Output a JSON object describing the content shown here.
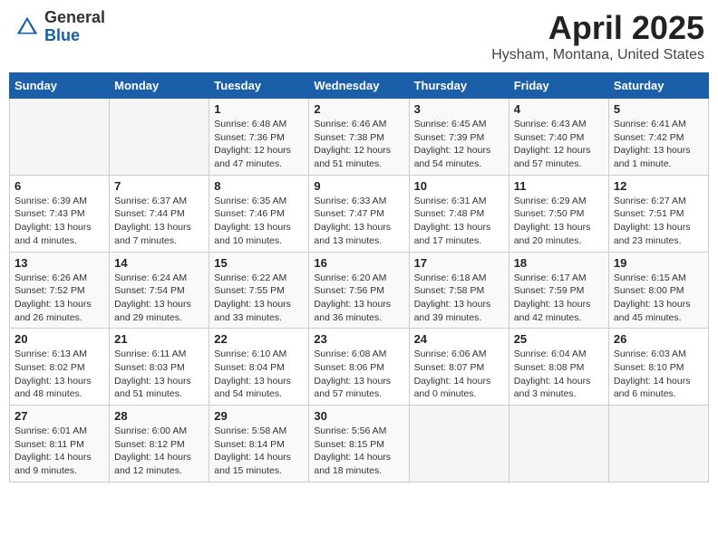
{
  "header": {
    "logo_general": "General",
    "logo_blue": "Blue",
    "title": "April 2025",
    "location": "Hysham, Montana, United States"
  },
  "calendar": {
    "headers": [
      "Sunday",
      "Monday",
      "Tuesday",
      "Wednesday",
      "Thursday",
      "Friday",
      "Saturday"
    ],
    "weeks": [
      [
        {
          "day": "",
          "info": ""
        },
        {
          "day": "",
          "info": ""
        },
        {
          "day": "1",
          "info": "Sunrise: 6:48 AM\nSunset: 7:36 PM\nDaylight: 12 hours\nand 47 minutes."
        },
        {
          "day": "2",
          "info": "Sunrise: 6:46 AM\nSunset: 7:38 PM\nDaylight: 12 hours\nand 51 minutes."
        },
        {
          "day": "3",
          "info": "Sunrise: 6:45 AM\nSunset: 7:39 PM\nDaylight: 12 hours\nand 54 minutes."
        },
        {
          "day": "4",
          "info": "Sunrise: 6:43 AM\nSunset: 7:40 PM\nDaylight: 12 hours\nand 57 minutes."
        },
        {
          "day": "5",
          "info": "Sunrise: 6:41 AM\nSunset: 7:42 PM\nDaylight: 13 hours\nand 1 minute."
        }
      ],
      [
        {
          "day": "6",
          "info": "Sunrise: 6:39 AM\nSunset: 7:43 PM\nDaylight: 13 hours\nand 4 minutes."
        },
        {
          "day": "7",
          "info": "Sunrise: 6:37 AM\nSunset: 7:44 PM\nDaylight: 13 hours\nand 7 minutes."
        },
        {
          "day": "8",
          "info": "Sunrise: 6:35 AM\nSunset: 7:46 PM\nDaylight: 13 hours\nand 10 minutes."
        },
        {
          "day": "9",
          "info": "Sunrise: 6:33 AM\nSunset: 7:47 PM\nDaylight: 13 hours\nand 13 minutes."
        },
        {
          "day": "10",
          "info": "Sunrise: 6:31 AM\nSunset: 7:48 PM\nDaylight: 13 hours\nand 17 minutes."
        },
        {
          "day": "11",
          "info": "Sunrise: 6:29 AM\nSunset: 7:50 PM\nDaylight: 13 hours\nand 20 minutes."
        },
        {
          "day": "12",
          "info": "Sunrise: 6:27 AM\nSunset: 7:51 PM\nDaylight: 13 hours\nand 23 minutes."
        }
      ],
      [
        {
          "day": "13",
          "info": "Sunrise: 6:26 AM\nSunset: 7:52 PM\nDaylight: 13 hours\nand 26 minutes."
        },
        {
          "day": "14",
          "info": "Sunrise: 6:24 AM\nSunset: 7:54 PM\nDaylight: 13 hours\nand 29 minutes."
        },
        {
          "day": "15",
          "info": "Sunrise: 6:22 AM\nSunset: 7:55 PM\nDaylight: 13 hours\nand 33 minutes."
        },
        {
          "day": "16",
          "info": "Sunrise: 6:20 AM\nSunset: 7:56 PM\nDaylight: 13 hours\nand 36 minutes."
        },
        {
          "day": "17",
          "info": "Sunrise: 6:18 AM\nSunset: 7:58 PM\nDaylight: 13 hours\nand 39 minutes."
        },
        {
          "day": "18",
          "info": "Sunrise: 6:17 AM\nSunset: 7:59 PM\nDaylight: 13 hours\nand 42 minutes."
        },
        {
          "day": "19",
          "info": "Sunrise: 6:15 AM\nSunset: 8:00 PM\nDaylight: 13 hours\nand 45 minutes."
        }
      ],
      [
        {
          "day": "20",
          "info": "Sunrise: 6:13 AM\nSunset: 8:02 PM\nDaylight: 13 hours\nand 48 minutes."
        },
        {
          "day": "21",
          "info": "Sunrise: 6:11 AM\nSunset: 8:03 PM\nDaylight: 13 hours\nand 51 minutes."
        },
        {
          "day": "22",
          "info": "Sunrise: 6:10 AM\nSunset: 8:04 PM\nDaylight: 13 hours\nand 54 minutes."
        },
        {
          "day": "23",
          "info": "Sunrise: 6:08 AM\nSunset: 8:06 PM\nDaylight: 13 hours\nand 57 minutes."
        },
        {
          "day": "24",
          "info": "Sunrise: 6:06 AM\nSunset: 8:07 PM\nDaylight: 14 hours\nand 0 minutes."
        },
        {
          "day": "25",
          "info": "Sunrise: 6:04 AM\nSunset: 8:08 PM\nDaylight: 14 hours\nand 3 minutes."
        },
        {
          "day": "26",
          "info": "Sunrise: 6:03 AM\nSunset: 8:10 PM\nDaylight: 14 hours\nand 6 minutes."
        }
      ],
      [
        {
          "day": "27",
          "info": "Sunrise: 6:01 AM\nSunset: 8:11 PM\nDaylight: 14 hours\nand 9 minutes."
        },
        {
          "day": "28",
          "info": "Sunrise: 6:00 AM\nSunset: 8:12 PM\nDaylight: 14 hours\nand 12 minutes."
        },
        {
          "day": "29",
          "info": "Sunrise: 5:58 AM\nSunset: 8:14 PM\nDaylight: 14 hours\nand 15 minutes."
        },
        {
          "day": "30",
          "info": "Sunrise: 5:56 AM\nSunset: 8:15 PM\nDaylight: 14 hours\nand 18 minutes."
        },
        {
          "day": "",
          "info": ""
        },
        {
          "day": "",
          "info": ""
        },
        {
          "day": "",
          "info": ""
        }
      ]
    ]
  }
}
